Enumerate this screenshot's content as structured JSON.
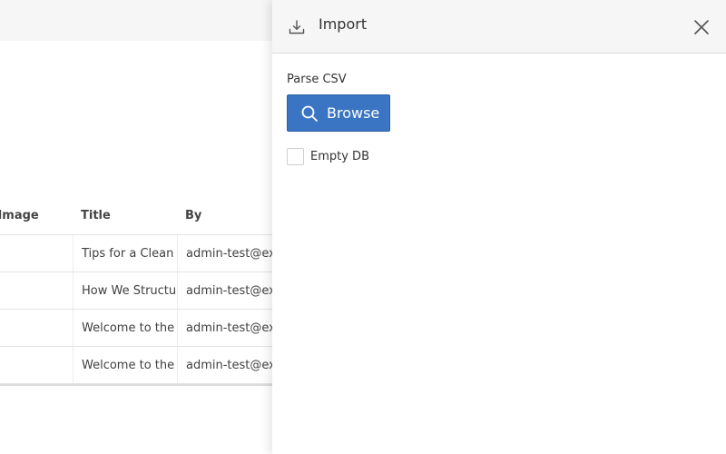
{
  "background_table": {
    "columns": [
      "o Image",
      "Title",
      "By"
    ],
    "rows": [
      {
        "title": "Tips for a Clean L",
        "by": "admin-test@exa"
      },
      {
        "title": "How We Structure",
        "by": "admin-test@exa"
      },
      {
        "title": "Welcome to the N",
        "by": "admin-test@exa"
      },
      {
        "title": "Welcome to the N",
        "by": "admin-test@exa"
      }
    ]
  },
  "drawer": {
    "title": "Import",
    "icon": "download-icon",
    "close_icon": "close-icon",
    "parse_label": "Parse CSV",
    "browse_label": "Browse",
    "browse_icon": "search-icon",
    "empty_db_label": "Empty DB",
    "empty_db_checked": false
  },
  "colors": {
    "primary": "#3a75c4",
    "header_bg": "#f6f6f6"
  }
}
